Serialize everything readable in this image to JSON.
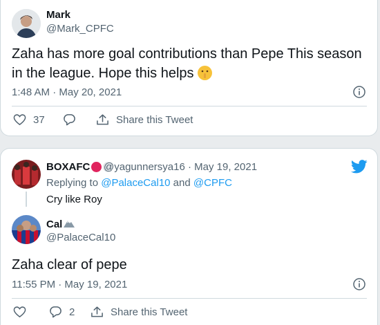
{
  "tweet1": {
    "name": "Mark",
    "handle": "@Mark_CPFC",
    "text": "Zaha has more goal contributions than Pepe This season in the league. Hope this helps",
    "emoji": "🤫",
    "timestamp": "1:48 AM · May 20, 2021",
    "likes": "37",
    "share_label": "Share this Tweet"
  },
  "tweet2_quoted": {
    "name": "BOXAFC",
    "handle": "@yagunnersya16",
    "dot_sep": "·",
    "date": "May 19, 2021",
    "replying_prefix": "Replying to ",
    "replying_user1": "@PalaceCal10",
    "replying_and": " and ",
    "replying_user2": "@CPFC",
    "text": "Cry like Roy"
  },
  "tweet2": {
    "name": "Cal",
    "handle": "@PalaceCal10",
    "text": "Zaha clear of pepe",
    "timestamp": "11:55 PM · May 19, 2021",
    "likes": "",
    "replies": "2",
    "share_label": "Share this Tweet"
  },
  "colors": {
    "accent": "#1d9bf0",
    "muted": "#536471",
    "red_dot": "#e0245e",
    "grey_dot": "#cfd9de"
  },
  "icons": [
    "heart-icon",
    "reply-icon",
    "share-icon",
    "info-icon",
    "twitter-bird-icon"
  ]
}
